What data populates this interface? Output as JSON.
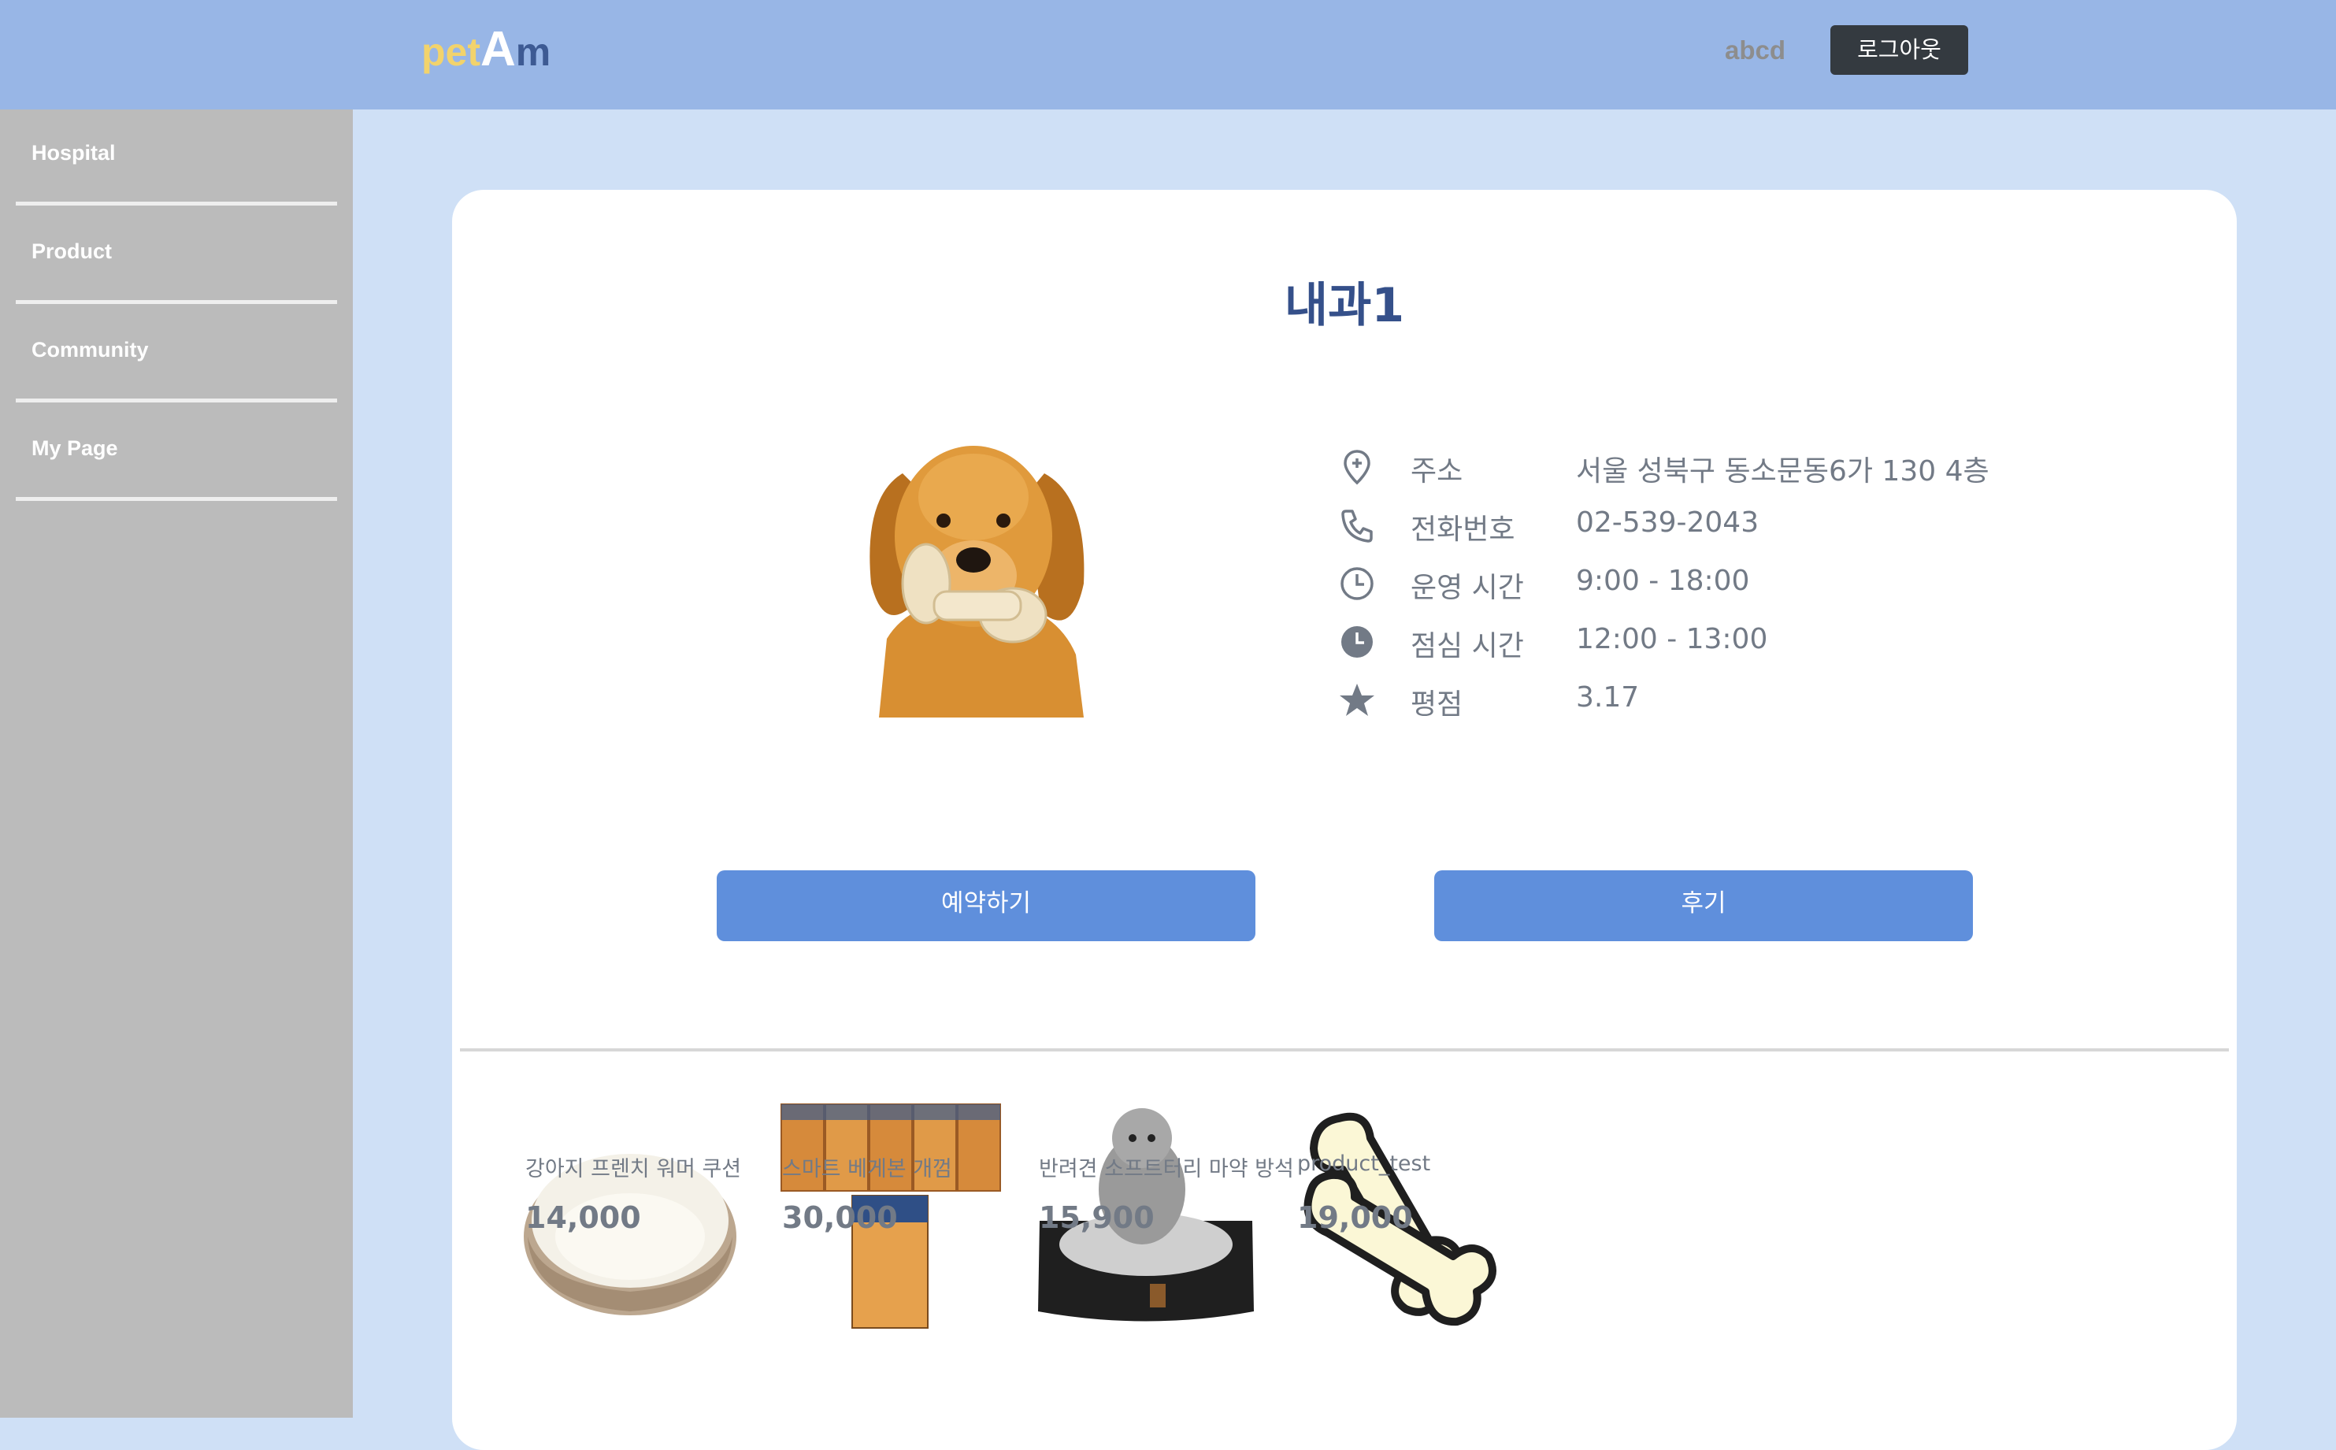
{
  "header": {
    "logo": {
      "part1": "pet",
      "part2": "A",
      "part3": "m"
    },
    "username": "abcd",
    "logout_label": "로그아웃"
  },
  "sidebar": {
    "items": [
      {
        "label": "Hospital"
      },
      {
        "label": "Product"
      },
      {
        "label": "Community"
      },
      {
        "label": "My Page"
      }
    ]
  },
  "hospital": {
    "name": "내과1",
    "photo_icon": "golden-retriever-photo",
    "info": [
      {
        "icon": "location-pin-icon",
        "label": "주소",
        "value": "서울 성북구 동소문동6가 130 4층"
      },
      {
        "icon": "phone-icon",
        "label": "전화번호",
        "value": "02-539-2043"
      },
      {
        "icon": "clock-outline-icon",
        "label": "운영 시간",
        "value": "9:00 - 18:00"
      },
      {
        "icon": "clock-filled-icon",
        "label": "점심 시간",
        "value": "12:00 - 13:00"
      },
      {
        "icon": "star-icon",
        "label": "평점",
        "value": "3.17"
      }
    ],
    "reserve_label": "예약하기",
    "review_label": "후기"
  },
  "products": [
    {
      "name": "강아지 프렌치 워머 쿠션",
      "price": "14,000",
      "image_icon": "pet-bed-image"
    },
    {
      "name": "스마트 베게본 개껌",
      "price": "30,000",
      "image_icon": "dog-chew-pack-image"
    },
    {
      "name": "반려견 소프트터리 마약 방석",
      "price": "15,900",
      "image_icon": "dog-cushion-image"
    },
    {
      "name": "product_test",
      "price": "19,000",
      "image_icon": "bone-drawing-image"
    }
  ],
  "colors": {
    "header_bg": "#98b6e6",
    "page_bg": "#cfe0f6",
    "sidebar_bg": "#bbbbbb",
    "button_bg": "#5f8fdc",
    "title_color": "#35508a",
    "logout_bg": "#343a40"
  }
}
